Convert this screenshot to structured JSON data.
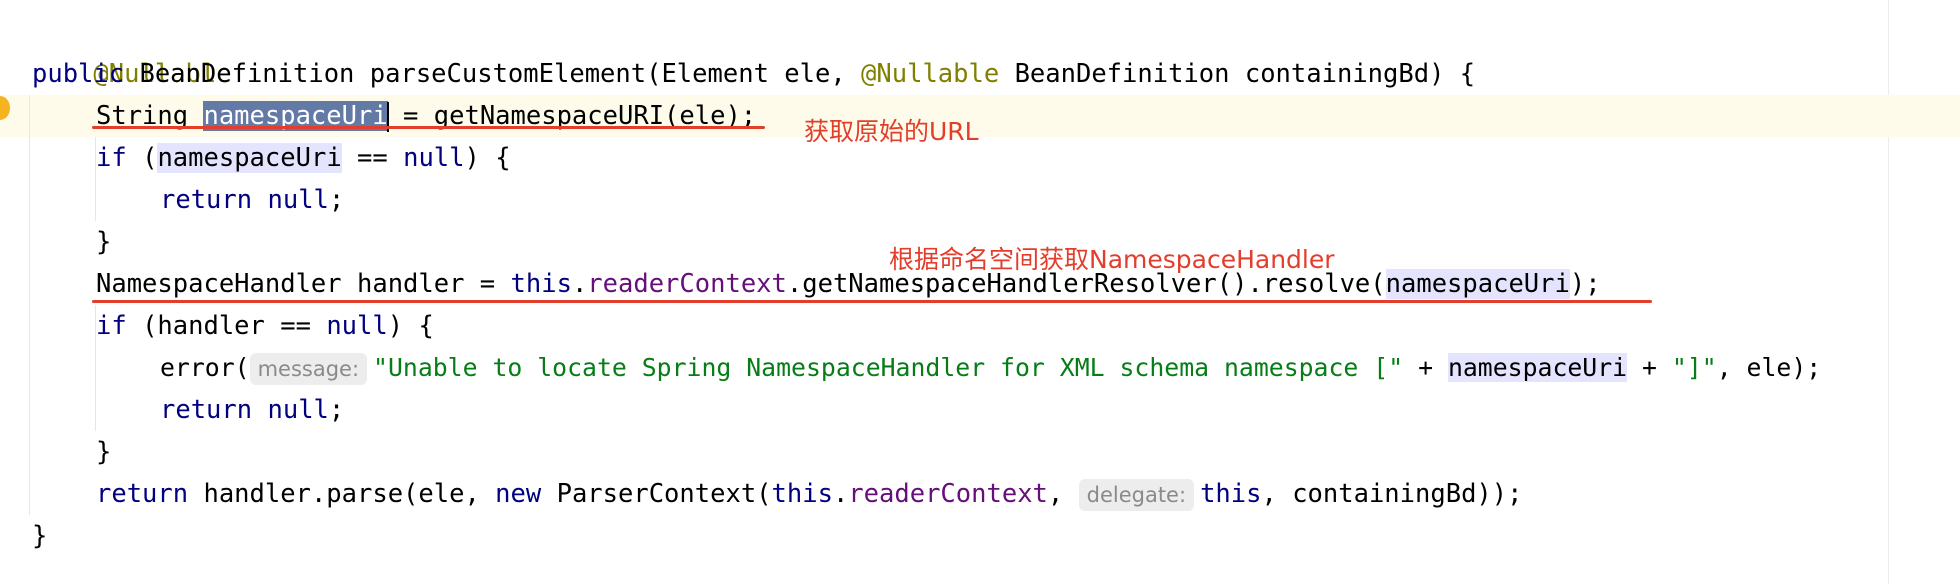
{
  "editor": {
    "annotation": "@Nullable",
    "line2": {
      "kw_public": "public",
      "text_a": " BeanDefinition parseCustomElement(Element ele, ",
      "ann_nullable": "@Nullable",
      "text_b": " BeanDefinition containingBd) {"
    },
    "line3": {
      "text_a": "String ",
      "selected": "namespaceUri",
      "text_b": " = getNamespaceURI(ele);"
    },
    "line4": {
      "kw_if": "if",
      "text_a": " (",
      "var": "namespaceUri",
      "text_b": " == ",
      "kw_null": "null",
      "text_c": ") {"
    },
    "line5": {
      "kw_return": "return",
      "text_a": " ",
      "kw_null": "null",
      "text_b": ";"
    },
    "line6": {
      "text": "}"
    },
    "line7": {
      "text_a": "NamespaceHandler handler = ",
      "kw_this": "this",
      "text_b": ".",
      "field": "readerContext",
      "text_c": ".getNamespaceHandlerResolver().resolve(",
      "var": "namespaceUri",
      "text_d": ");"
    },
    "line8": {
      "kw_if": "if",
      "text_a": " (handler == ",
      "kw_null": "null",
      "text_b": ") {"
    },
    "line9": {
      "text_a": "error(",
      "hint": "message:",
      "string": "\"Unable to locate Spring NamespaceHandler for XML schema namespace [\"",
      "text_b": " + ",
      "var": "namespaceUri",
      "text_c": " + ",
      "string2": "\"]\"",
      "text_d": ", ele);"
    },
    "line10": {
      "kw_return": "return",
      "text_a": " ",
      "kw_null": "null",
      "text_b": ";"
    },
    "line11": {
      "text": "}"
    },
    "line12": {
      "kw_return": "return",
      "text_a": " handler.parse(ele, ",
      "kw_new": "new",
      "text_b": " ParserContext(",
      "kw_this": "this",
      "text_c": ".",
      "field": "readerContext",
      "text_d": ", ",
      "hint": "delegate:",
      "kw_this2": "this",
      "text_e": ", containingBd));"
    },
    "line13": {
      "text": "}"
    }
  },
  "notes": {
    "note1": "获取原始的URL",
    "note2": "根据命名空间获取NamespaceHandler"
  },
  "colors": {
    "keyword": "#000080",
    "annotation": "#808000",
    "field": "#660e7a",
    "string": "#067d17",
    "red_markup": "#e33d2b"
  }
}
